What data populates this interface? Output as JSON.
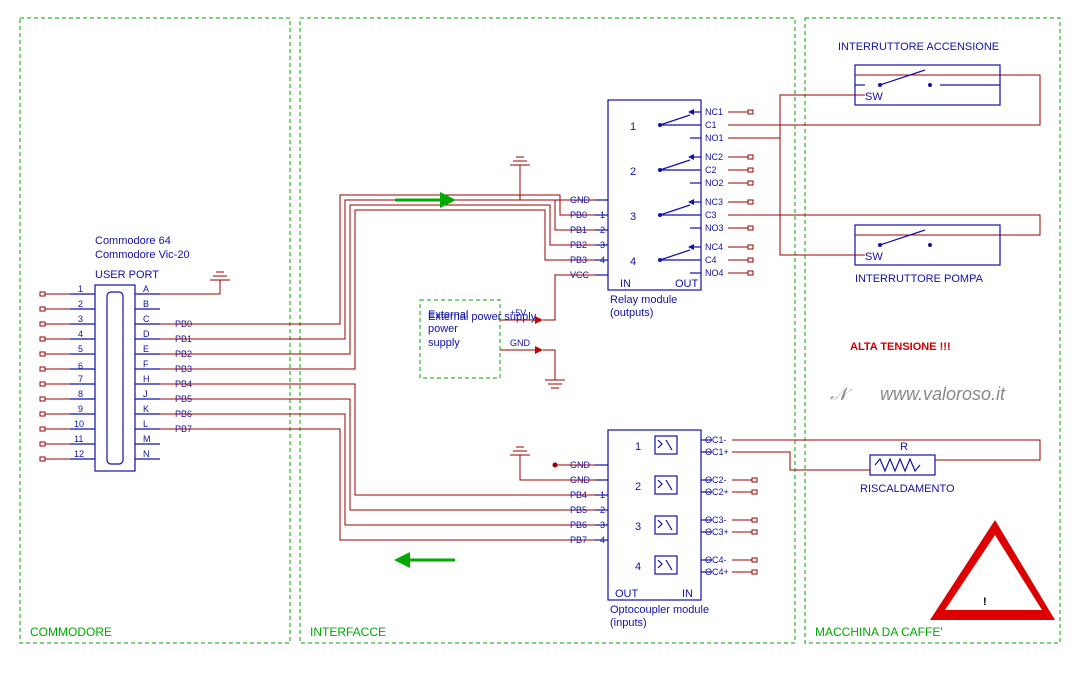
{
  "sections": {
    "left": "COMMODORE",
    "mid": "INTERFACCE",
    "right": "MACCHINA DA CAFFE'"
  },
  "commodore": {
    "line1": "Commodore 64",
    "line2": "Commodore Vic-20",
    "label": "USER PORT",
    "leftnums": [
      "1",
      "2",
      "3",
      "4",
      "5",
      "6",
      "7",
      "8",
      "9",
      "10",
      "11",
      "12"
    ],
    "rightltrs": [
      "A",
      "B",
      "C",
      "D",
      "E",
      "F",
      "H",
      "J",
      "K",
      "L",
      "M",
      "N"
    ],
    "pb": [
      "PB0",
      "PB1",
      "PB2",
      "PB3",
      "PB4",
      "PB5",
      "PB6",
      "PB7"
    ]
  },
  "psu": {
    "title": "External power supply",
    "p5": "+5V",
    "gnd": "GND"
  },
  "relay": {
    "gnd": "GND",
    "pins": [
      "PB0",
      "PB1",
      "PB2",
      "PB3"
    ],
    "nums": [
      "1",
      "2",
      "3",
      "4"
    ],
    "vcc": "VCC",
    "chn": [
      "1",
      "2",
      "3",
      "4"
    ],
    "in": "IN",
    "out": "OUT",
    "title1": "Relay module",
    "title2": "(outputs)",
    "terms": [
      "NC1",
      "C1",
      "NO1",
      "NC2",
      "C2",
      "NO2",
      "NC3",
      "C3",
      "NO3",
      "NC4",
      "C4",
      "NO4"
    ]
  },
  "opto": {
    "gnd": "GND",
    "pins": [
      "PB4",
      "PB5",
      "PB6",
      "PB7"
    ],
    "nums": [
      "1",
      "2",
      "3",
      "4"
    ],
    "chn": [
      "1",
      "2",
      "3",
      "4"
    ],
    "out": "OUT",
    "in": "IN",
    "title1": "Optocoupler module",
    "title2": "(inputs)",
    "terms": [
      "OC1-",
      "OC1+",
      "OC2-",
      "OC2+",
      "OC3-",
      "OC3+",
      "OC4-",
      "OC4+"
    ]
  },
  "machine": {
    "sw": "SW",
    "label1": "INTERRUTTORE ACCENSIONE",
    "label2": "INTERRUTTORE POMPA",
    "r": "R",
    "rlabel": "RISCALDAMENTO",
    "warn": "ALTA TENSIONE !!!",
    "url": "www.valoroso.it"
  }
}
